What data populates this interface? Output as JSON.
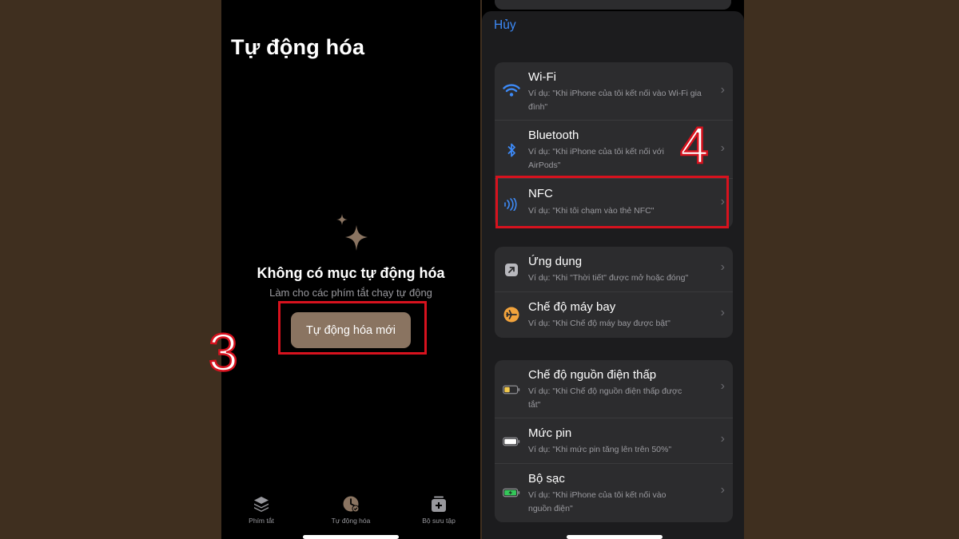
{
  "left": {
    "title": "Tự động hóa",
    "empty_title": "Không có mục tự động hóa",
    "empty_subtitle": "Làm cho các phím tắt chạy tự động",
    "new_button": "Tự động hóa mới",
    "step_label": "3",
    "tabs": [
      {
        "label": "Phím tắt",
        "icon": "layers-icon"
      },
      {
        "label": "Tự động hóa",
        "icon": "clock-check-icon"
      },
      {
        "label": "Bộ sưu tập",
        "icon": "gallery-add-icon"
      }
    ]
  },
  "right": {
    "cancel": "Hủy",
    "step_label": "4",
    "groups": [
      {
        "items": [
          {
            "title": "Wi-Fi",
            "subtitle": "Ví dụ: \"Khi iPhone của tôi kết nối vào Wi-Fi gia đình\"",
            "icon": "wifi-icon"
          },
          {
            "title": "Bluetooth",
            "subtitle": "Ví dụ: \"Khi iPhone của tôi kết nối với AirPods\"",
            "icon": "bluetooth-icon"
          },
          {
            "title": "NFC",
            "subtitle": "Ví dụ: \"Khi tôi chạm vào thẻ NFC\"",
            "icon": "nfc-icon"
          }
        ]
      },
      {
        "items": [
          {
            "title": "Ứng dụng",
            "subtitle": "Ví dụ: \"Khi \"Thời tiết\" được mở hoặc đóng\"",
            "icon": "app-arrow-icon"
          },
          {
            "title": "Chế độ máy bay",
            "subtitle": "Ví dụ: \"Khi Chế độ máy bay được bật\"",
            "icon": "airplane-icon"
          }
        ]
      },
      {
        "items": [
          {
            "title": "Chế độ nguồn điện thấp",
            "subtitle": "Ví dụ: \"Khi Chế độ nguồn điện thấp được tắt\"",
            "icon": "low-battery-icon"
          },
          {
            "title": "Mức pin",
            "subtitle": "Ví dụ: \"Khi mức pin tăng lên trên 50%\"",
            "icon": "battery-icon"
          },
          {
            "title": "Bộ sạc",
            "subtitle": "Ví dụ: \"Khi iPhone của tôi kết nối vào nguồn điện\"",
            "icon": "charging-battery-icon"
          }
        ]
      }
    ]
  },
  "colors": {
    "background": "#3f2f1f",
    "accent_blue": "#3d8af7",
    "button_brown": "#8a7461",
    "highlight_red": "#d7121e",
    "airplane_orange": "#f2a33c",
    "battery_yellow": "#f2c94c",
    "battery_green": "#34c759"
  }
}
